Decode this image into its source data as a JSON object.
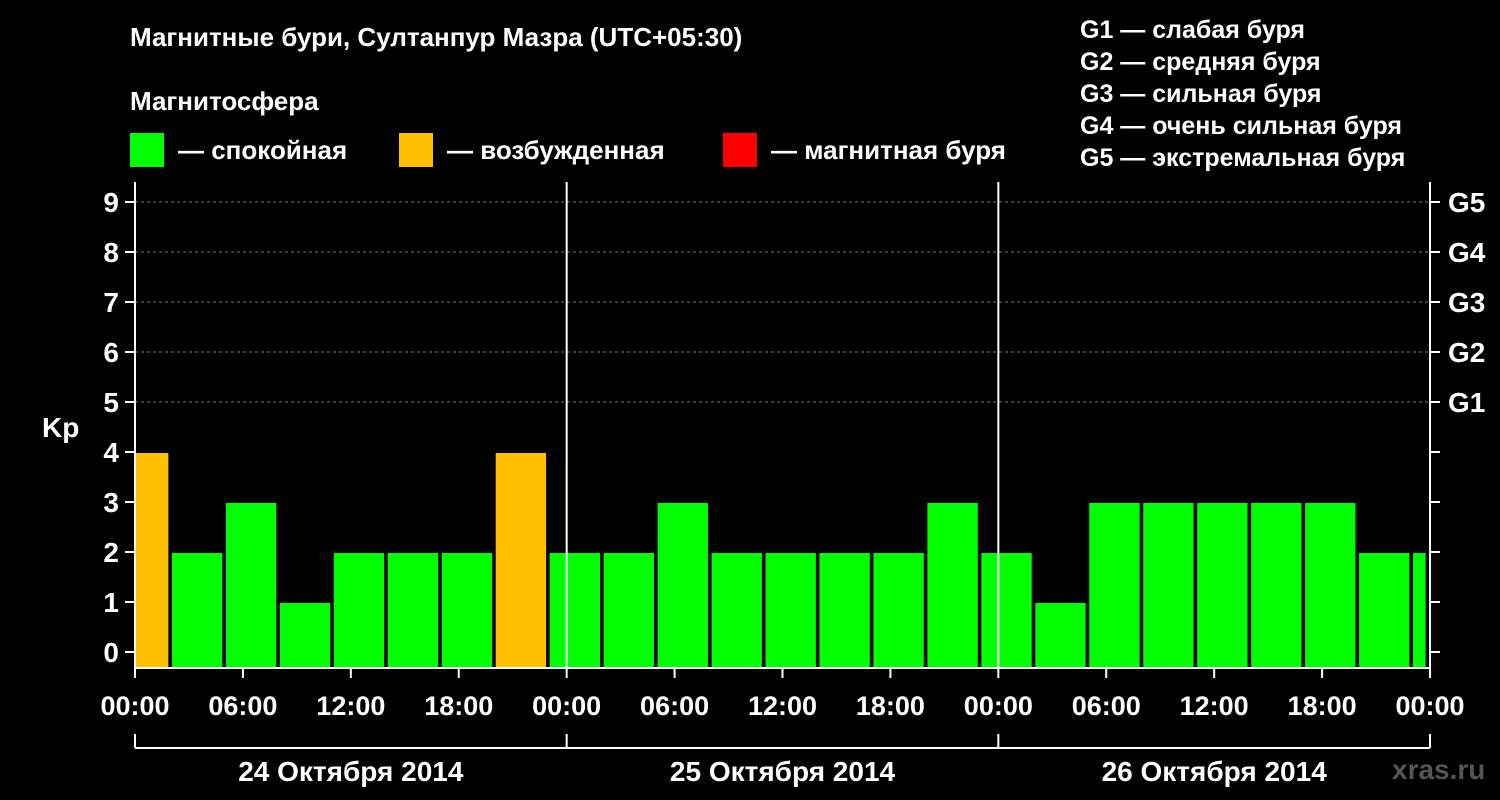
{
  "header": {
    "title": "Магнитные бури, Султанпур Мазра (UTC+05:30)",
    "magnetosphere_title": "Магнитосфера"
  },
  "legend": [
    {
      "label": "— спокойная",
      "color": "#00ff00"
    },
    {
      "label": "— возбужденная",
      "color": "#ffc000"
    },
    {
      "label": "— магнитная буря",
      "color": "#ff0000"
    }
  ],
  "g_scale": [
    "G1 — слабая буря",
    "G2 — средняя буря",
    "G3 — сильная буря",
    "G4 — очень сильная буря",
    "G5 — экстремальная буря"
  ],
  "watermark": "xras.ru",
  "chart_data": {
    "type": "bar",
    "ylabel": "Kp",
    "ylim": [
      0,
      9
    ],
    "yticks": [
      "0",
      "1",
      "2",
      "3",
      "4",
      "5",
      "6",
      "7",
      "8",
      "9"
    ],
    "right_ticks": [
      {
        "y": 5,
        "label": "G1"
      },
      {
        "y": 6,
        "label": "G2"
      },
      {
        "y": 7,
        "label": "G3"
      },
      {
        "y": 8,
        "label": "G4"
      },
      {
        "y": 9,
        "label": "G5"
      }
    ],
    "x_tick_labels": [
      "00:00",
      "06:00",
      "12:00",
      "18:00",
      "00:00",
      "06:00",
      "12:00",
      "18:00",
      "00:00",
      "06:00",
      "12:00",
      "18:00",
      "00:00"
    ],
    "x_tick_hours": [
      0,
      6,
      12,
      18,
      24,
      30,
      36,
      42,
      48,
      54,
      60,
      66,
      72
    ],
    "day_labels": [
      "24 Октября 2014",
      "25 Октября 2014",
      "26 Октября 2014"
    ],
    "x_range_hours": [
      0,
      72
    ],
    "grid": "horizontal dashed",
    "bars": [
      {
        "start": 0,
        "end": 1.8,
        "kp": 4,
        "color": "#ffc000"
      },
      {
        "start": 2,
        "end": 4.8,
        "kp": 2,
        "color": "#00ff00"
      },
      {
        "start": 5,
        "end": 7.8,
        "kp": 3,
        "color": "#00ff00"
      },
      {
        "start": 8,
        "end": 10.8,
        "kp": 1,
        "color": "#00ff00"
      },
      {
        "start": 11,
        "end": 13.8,
        "kp": 2,
        "color": "#00ff00"
      },
      {
        "start": 14,
        "end": 16.8,
        "kp": 2,
        "color": "#00ff00"
      },
      {
        "start": 17,
        "end": 19.8,
        "kp": 2,
        "color": "#00ff00"
      },
      {
        "start": 20,
        "end": 22.8,
        "kp": 4,
        "color": "#ffc000"
      },
      {
        "start": 23,
        "end": 25.8,
        "kp": 2,
        "color": "#00ff00"
      },
      {
        "start": 26,
        "end": 28.8,
        "kp": 2,
        "color": "#00ff00"
      },
      {
        "start": 29,
        "end": 31.8,
        "kp": 3,
        "color": "#00ff00"
      },
      {
        "start": 32,
        "end": 34.8,
        "kp": 2,
        "color": "#00ff00"
      },
      {
        "start": 35,
        "end": 37.8,
        "kp": 2,
        "color": "#00ff00"
      },
      {
        "start": 38,
        "end": 40.8,
        "kp": 2,
        "color": "#00ff00"
      },
      {
        "start": 41,
        "end": 43.8,
        "kp": 2,
        "color": "#00ff00"
      },
      {
        "start": 44,
        "end": 46.8,
        "kp": 3,
        "color": "#00ff00"
      },
      {
        "start": 47,
        "end": 49.8,
        "kp": 2,
        "color": "#00ff00"
      },
      {
        "start": 50,
        "end": 52.8,
        "kp": 1,
        "color": "#00ff00"
      },
      {
        "start": 53,
        "end": 55.8,
        "kp": 3,
        "color": "#00ff00"
      },
      {
        "start": 56,
        "end": 58.8,
        "kp": 3,
        "color": "#00ff00"
      },
      {
        "start": 59,
        "end": 61.8,
        "kp": 3,
        "color": "#00ff00"
      },
      {
        "start": 62,
        "end": 64.8,
        "kp": 3,
        "color": "#00ff00"
      },
      {
        "start": 65,
        "end": 67.8,
        "kp": 3,
        "color": "#00ff00"
      },
      {
        "start": 68,
        "end": 70.8,
        "kp": 2,
        "color": "#00ff00"
      },
      {
        "start": 71,
        "end": 71.7,
        "kp": 2,
        "color": "#00ff00"
      }
    ]
  }
}
